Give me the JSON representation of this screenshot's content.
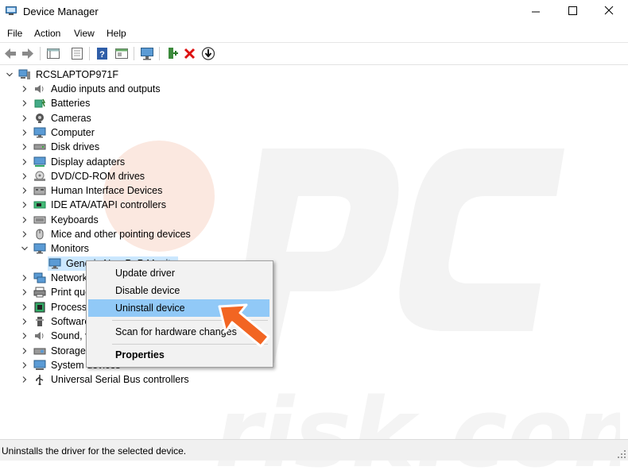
{
  "window": {
    "title": "Device Manager",
    "controls": [
      "minimize",
      "maximize",
      "close"
    ]
  },
  "menubar": {
    "items": [
      "File",
      "Action",
      "View",
      "Help"
    ]
  },
  "toolbar": {
    "icons": [
      "back-icon",
      "forward-icon",
      "properties-pane-icon",
      "show-hidden-icon",
      "help-icon",
      "update-driver-icon",
      "scan-monitor-icon",
      "add-driver-icon",
      "uninstall-x-icon",
      "download-driver-icon"
    ]
  },
  "tree": {
    "root": "RCSLAPTOP971F",
    "categories": [
      "Audio inputs and outputs",
      "Batteries",
      "Cameras",
      "Computer",
      "Disk drives",
      "Display adapters",
      "DVD/CD-ROM drives",
      "Human Interface Devices",
      "IDE ATA/ATAPI controllers",
      "Keyboards",
      "Mice and other pointing devices",
      "Monitors"
    ],
    "monitor_child": "Generic Non-PnP Monitor",
    "after": [
      "Network adapters",
      "Print queues",
      "Processors",
      "Software devices",
      "Sound, video and game controllers",
      "Storage controllers",
      "System devices",
      "Universal Serial Bus controllers"
    ]
  },
  "context_menu": {
    "items": [
      "Update driver",
      "Disable device",
      "Uninstall device",
      "Scan for hardware changes",
      "Properties"
    ],
    "highlighted": "Uninstall device"
  },
  "statusbar": {
    "text": "Uninstalls the driver for the selected device."
  },
  "colors": {
    "highlight": "#91c9f7",
    "selection": "#cce8ff",
    "arrow": "#f26522"
  }
}
